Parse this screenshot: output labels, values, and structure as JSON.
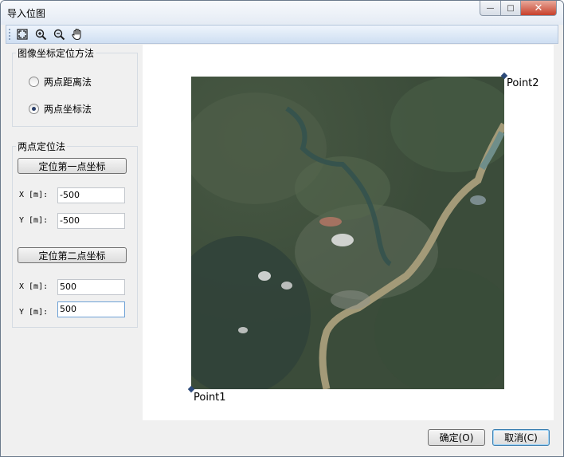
{
  "window": {
    "title": "导入位图",
    "controls": {
      "minimize": "—",
      "maximize": "□",
      "close": "✕"
    }
  },
  "toolbar": {
    "tools": [
      {
        "name": "full-extent-icon",
        "tooltip": ""
      },
      {
        "name": "zoom-in-icon",
        "tooltip": ""
      },
      {
        "name": "zoom-out-icon",
        "tooltip": ""
      },
      {
        "name": "pan-hand-icon",
        "tooltip": ""
      }
    ]
  },
  "method_group": {
    "title": "图像坐标定位方法",
    "options": [
      {
        "label": "两点距离法",
        "selected": false
      },
      {
        "label": "两点坐标法",
        "selected": true
      }
    ]
  },
  "two_point_group": {
    "title": "两点定位法",
    "first_button": "定位第一点坐标",
    "second_button": "定位第二点坐标",
    "p1": {
      "x_label": "X [m]:",
      "x_value": "-500",
      "y_label": "Y [m]:",
      "y_value": "-500"
    },
    "p2": {
      "x_label": "X [m]:",
      "x_value": "500",
      "y_label": "Y [m]:",
      "y_value": "500"
    }
  },
  "canvas": {
    "point1_label": "Point1",
    "point2_label": "Point2"
  },
  "footer": {
    "ok_label": "确定(O)",
    "cancel_label": "取消(C)"
  },
  "colors": {
    "toolbar_top": "#eef4fc",
    "toolbar_bottom": "#cfdff2",
    "marker": "#2c4a7a",
    "close_button": "#c7402b"
  }
}
